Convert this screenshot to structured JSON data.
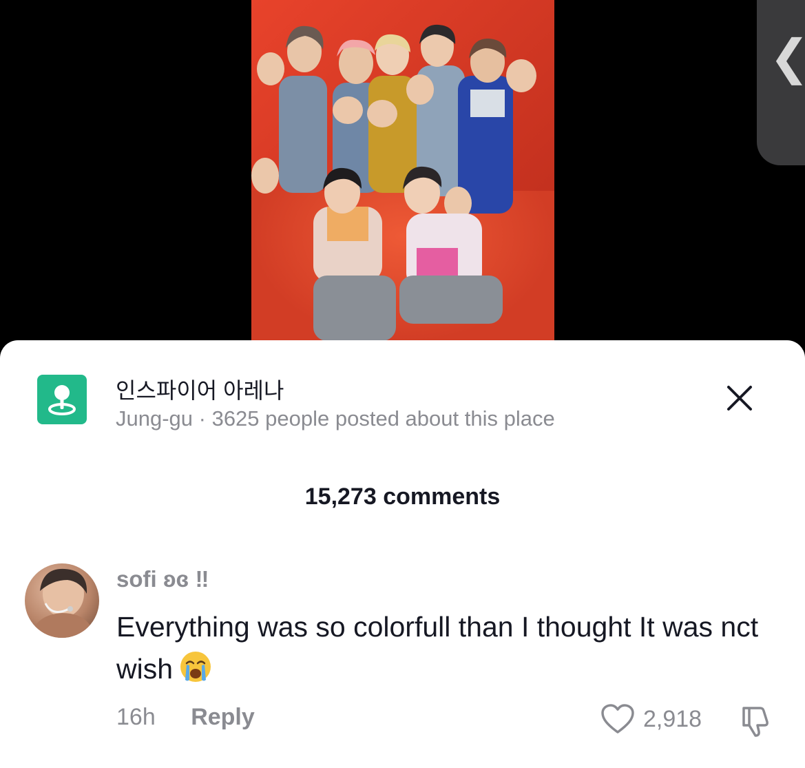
{
  "video": {
    "description_icon": "photo-thumbnail"
  },
  "side_panel": {
    "chevron_icon": "chevron-left-icon",
    "chevron_glyph": "❮"
  },
  "place": {
    "icon": "map-pin-icon",
    "icon_color": "#22b98a",
    "title": "인스파이어 아레나",
    "subtitle": "Jung-gu · 3625 people posted about this place"
  },
  "comments": {
    "count_label": "15,273 comments",
    "items": [
      {
        "username": "sofi ʚɞ ‼︎",
        "text": "Everything was so colorfull than I thought It was nct wish",
        "emoji": "loudly-crying-face",
        "time": "16h",
        "reply_label": "Reply",
        "like_count": "2,918"
      }
    ]
  }
}
